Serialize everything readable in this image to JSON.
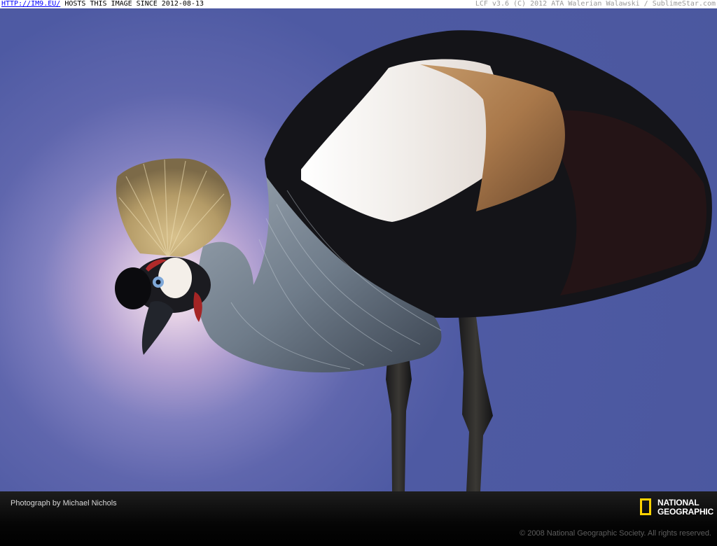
{
  "banner": {
    "link_text": "HTTP://IM9.EU/",
    "message": " HOSTS THIS IMAGE SINCE 2012-08-13",
    "right_text": "LCF v3.6 (C) 2012 ATA Walerian Walawski / SublimeStar.com"
  },
  "photo": {
    "subject": "grey-crowned-crane",
    "colors": {
      "sky": "#4e5aa3",
      "glow": "#f6eef4"
    }
  },
  "caption": {
    "credit": "Photograph by Michael Nichols",
    "copyright": "© 2008 National Geographic Society. All rights reserved.",
    "logo_line1": "NATIONAL",
    "logo_line2": "GEOGRAPHIC",
    "logo_color": "#ffd200"
  }
}
